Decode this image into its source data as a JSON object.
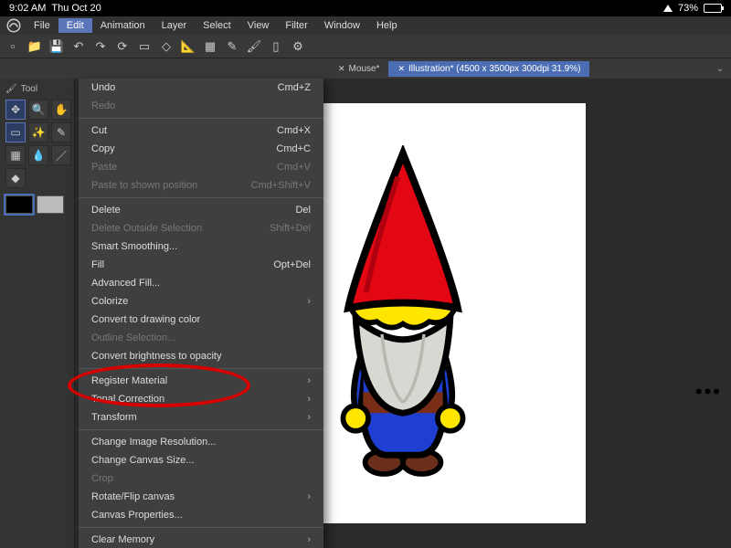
{
  "status": {
    "time": "9:02 AM",
    "date": "Thu Oct 20",
    "battery_pct": "73%"
  },
  "menubar": {
    "items": [
      "File",
      "Edit",
      "Animation",
      "Layer",
      "Select",
      "View",
      "Filter",
      "Window",
      "Help"
    ],
    "active_index": 1
  },
  "tabs": {
    "inactive": "Mouse*",
    "active": "Illustration* (4500 x 3500px 300dpi 31.9%)"
  },
  "tool_panel_label": "Tool",
  "edit_menu": {
    "groups": [
      [
        {
          "label": "Undo",
          "shortcut": "Cmd+Z",
          "enabled": true
        },
        {
          "label": "Redo",
          "shortcut": "",
          "enabled": false
        }
      ],
      [
        {
          "label": "Cut",
          "shortcut": "Cmd+X",
          "enabled": true
        },
        {
          "label": "Copy",
          "shortcut": "Cmd+C",
          "enabled": true
        },
        {
          "label": "Paste",
          "shortcut": "Cmd+V",
          "enabled": false
        },
        {
          "label": "Paste to shown position",
          "shortcut": "Cmd+Shift+V",
          "enabled": false
        }
      ],
      [
        {
          "label": "Delete",
          "shortcut": "Del",
          "enabled": true
        },
        {
          "label": "Delete Outside Selection",
          "shortcut": "Shift+Del",
          "enabled": false
        },
        {
          "label": "Smart Smoothing...",
          "shortcut": "",
          "enabled": true
        },
        {
          "label": "Fill",
          "shortcut": "Opt+Del",
          "enabled": true
        },
        {
          "label": "Advanced Fill...",
          "shortcut": "",
          "enabled": true
        },
        {
          "label": "Colorize",
          "shortcut": "",
          "enabled": true,
          "submenu": true
        },
        {
          "label": "Convert to drawing color",
          "shortcut": "",
          "enabled": true
        },
        {
          "label": "Outline Selection...",
          "shortcut": "",
          "enabled": false
        },
        {
          "label": "Convert brightness to opacity",
          "shortcut": "",
          "enabled": true
        }
      ],
      [
        {
          "label": "Register Material",
          "shortcut": "",
          "enabled": true,
          "submenu": true
        },
        {
          "label": "Tonal Correction",
          "shortcut": "",
          "enabled": true,
          "submenu": true
        },
        {
          "label": "Transform",
          "shortcut": "",
          "enabled": true,
          "submenu": true
        }
      ],
      [
        {
          "label": "Change Image Resolution...",
          "shortcut": "",
          "enabled": true
        },
        {
          "label": "Change Canvas Size...",
          "shortcut": "",
          "enabled": true
        },
        {
          "label": "Crop",
          "shortcut": "",
          "enabled": false
        },
        {
          "label": "Rotate/Flip canvas",
          "shortcut": "",
          "enabled": true,
          "submenu": true
        },
        {
          "label": "Canvas Properties...",
          "shortcut": "",
          "enabled": true
        }
      ],
      [
        {
          "label": "Clear Memory",
          "shortcut": "",
          "enabled": true,
          "submenu": true
        }
      ]
    ]
  }
}
